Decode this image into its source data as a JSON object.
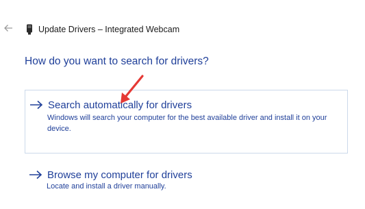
{
  "window": {
    "title": "Update Drivers – Integrated Webcam",
    "back_icon": "back-arrow-icon",
    "device_icon": "webcam-device-icon"
  },
  "main": {
    "question": "How do you want to search for drivers?",
    "options": [
      {
        "title": "Search automatically for drivers",
        "description": "Windows will search your computer for the best available driver and install it on your device.",
        "icon": "right-arrow-icon"
      },
      {
        "title": "Browse my computer for drivers",
        "description": "Locate and install a driver manually.",
        "icon": "right-arrow-icon"
      }
    ]
  },
  "colors": {
    "accent": "#1f3f99",
    "option_border": "#cbd9ea",
    "annotation": "#e53935"
  }
}
